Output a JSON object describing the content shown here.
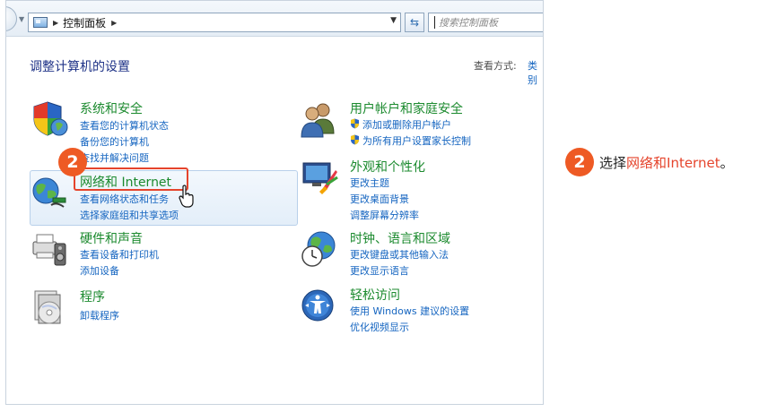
{
  "toolbar": {
    "breadcrumb": "控制面板",
    "search_placeholder": "搜索控制面板"
  },
  "page": {
    "title": "调整计算机的设置",
    "view_by_label": "查看方式:",
    "view_by_value": "类别"
  },
  "categories": [
    {
      "title": "系统和安全",
      "links": [
        "查看您的计算机状态",
        "备份您的计算机",
        "查找并解决问题"
      ]
    },
    {
      "title": "网络和 Internet",
      "links": [
        "查看网络状态和任务",
        "选择家庭组和共享选项"
      ]
    },
    {
      "title": "硬件和声音",
      "links": [
        "查看设备和打印机",
        "添加设备"
      ]
    },
    {
      "title": "程序",
      "links": [
        "卸载程序"
      ]
    },
    {
      "title": "用户帐户和家庭安全",
      "links": [
        "添加或删除用户帐户",
        "为所有用户设置家长控制"
      ]
    },
    {
      "title": "外观和个性化",
      "links": [
        "更改主题",
        "更改桌面背景",
        "调整屏幕分辨率"
      ]
    },
    {
      "title": "时钟、语言和区域",
      "links": [
        "更改键盘或其他输入法",
        "更改显示语言"
      ]
    },
    {
      "title": "轻松访问",
      "links": [
        "使用 Windows 建议的设置",
        "优化视频显示"
      ]
    }
  ],
  "step": {
    "number": "2",
    "text_prefix": "选择",
    "text_highlight": "网络和Internet",
    "text_suffix": "。"
  },
  "colors": {
    "category_title": "#1b8a2e",
    "link": "#1565c0",
    "accent": "#ee5a24",
    "highlight_border": "#e5442c"
  }
}
